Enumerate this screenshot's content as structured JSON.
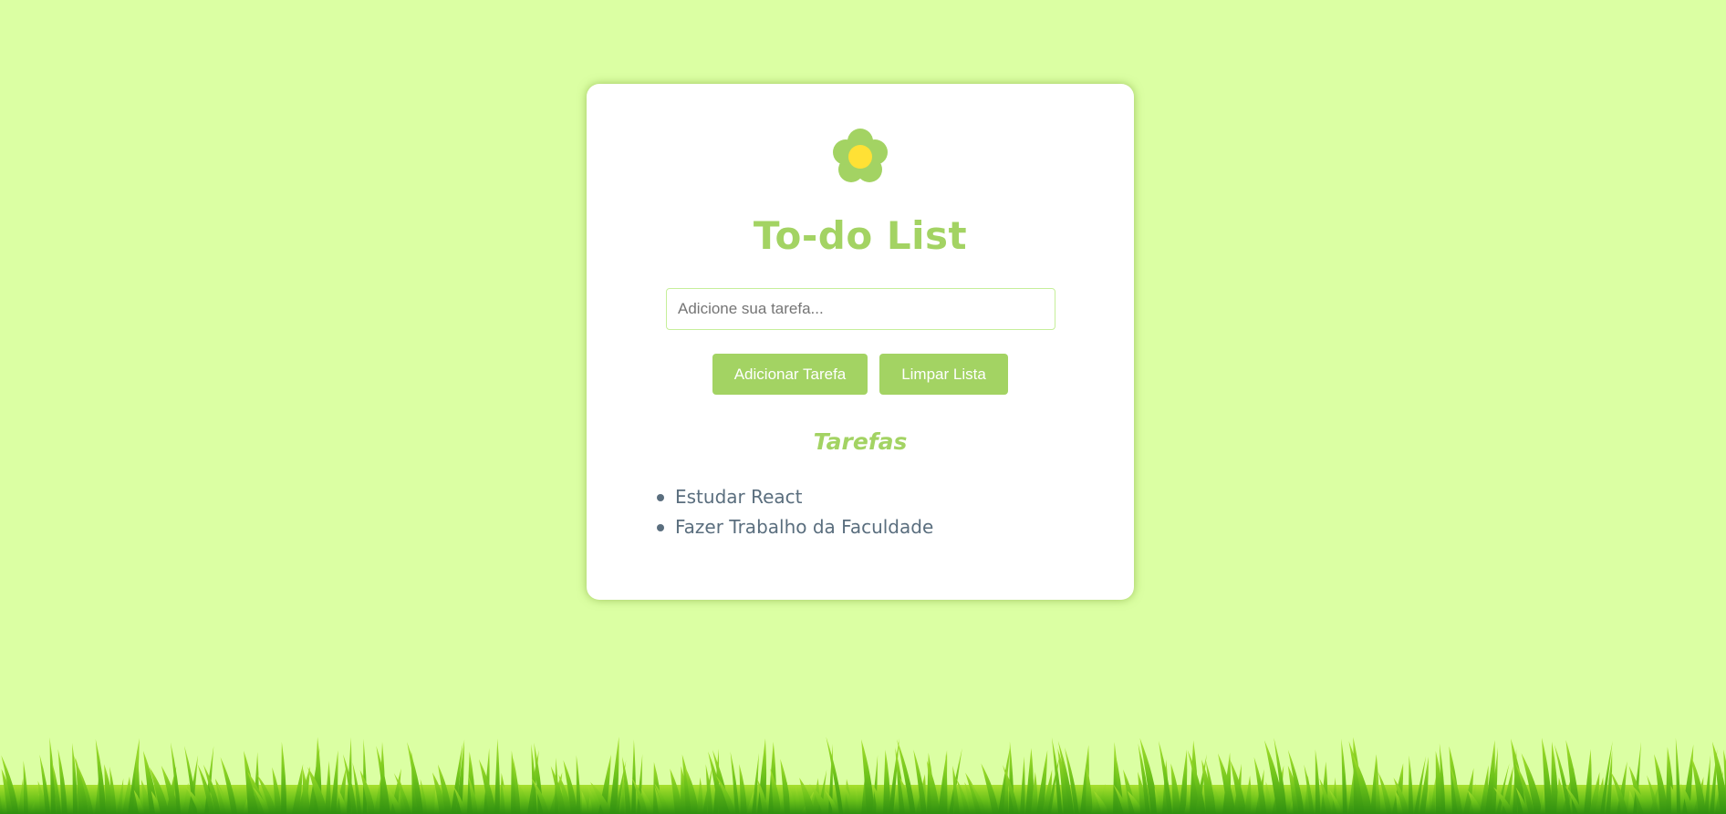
{
  "app": {
    "title": "To-do List",
    "subtitle": "Tarefas"
  },
  "form": {
    "input_value": "",
    "input_placeholder": "Adicione sua tarefa...",
    "add_label": "Adicionar Tarefa",
    "clear_label": "Limpar Lista"
  },
  "tasks": [
    {
      "label": "Estudar React"
    },
    {
      "label": "Fazer Trabalho da Faculdade"
    }
  ],
  "icons": {
    "logo": "flower-icon",
    "footer": "grass-decoration"
  },
  "colors": {
    "background": "#dbffa3",
    "accent": "#a3d363",
    "flower_center": "#ffe135",
    "text": "#5a6e7e"
  }
}
